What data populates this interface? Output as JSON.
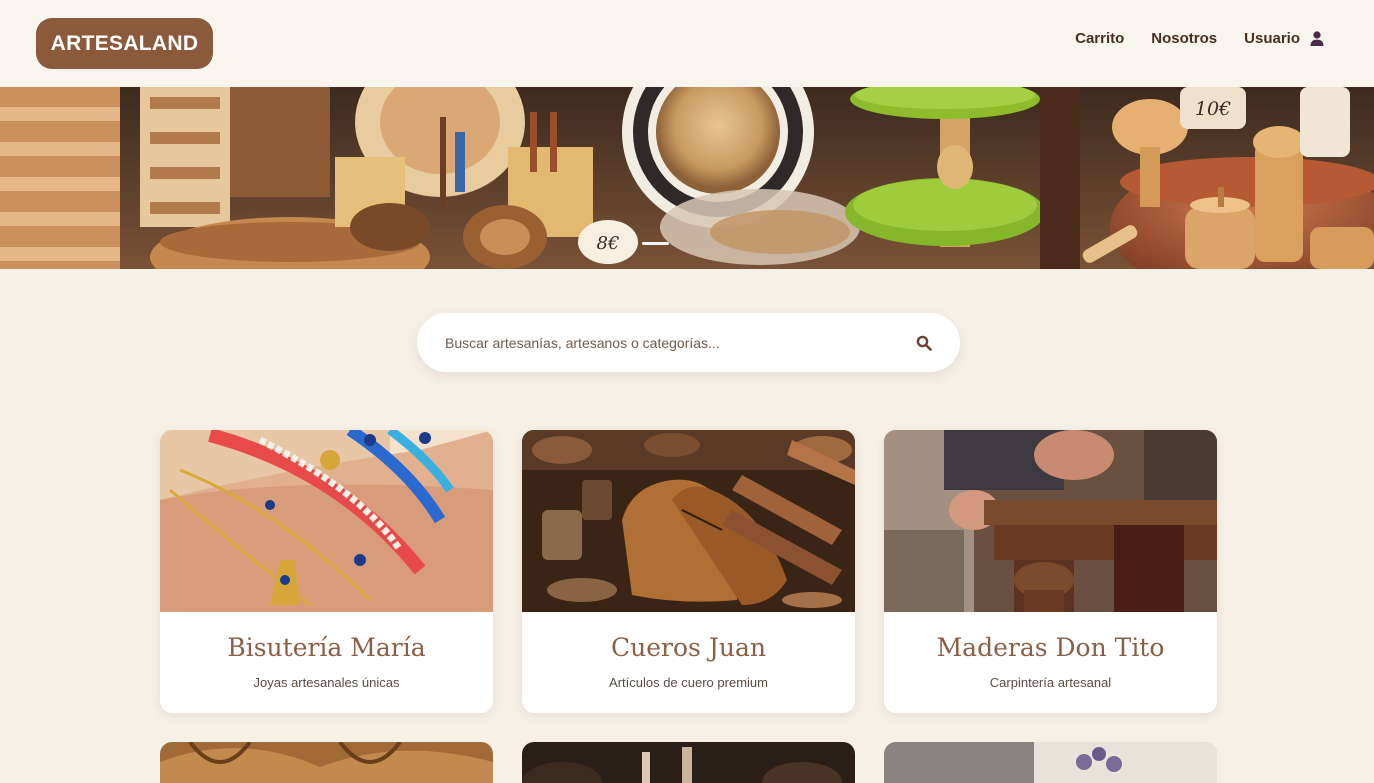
{
  "header": {
    "logo": "ARTESALAND",
    "nav": [
      {
        "label": "Carrito"
      },
      {
        "label": "Nosotros"
      },
      {
        "label": "Usuario"
      }
    ]
  },
  "hero": {
    "price_tags": [
      "8€",
      "10€"
    ]
  },
  "search": {
    "placeholder": "Buscar artesanías, artesanos o categorías..."
  },
  "cards": [
    {
      "title": "Bisutería María",
      "subtitle": "Joyas artesanales únicas"
    },
    {
      "title": "Cueros Juan",
      "subtitle": "Artículos de cuero premium"
    },
    {
      "title": "Maderas Don Tito",
      "subtitle": "Carpintería artesanal"
    }
  ],
  "colors": {
    "background": "#f6f0e7",
    "brand": "#8a5a3b",
    "nav_text": "#4a2f1f",
    "card_title": "#8a5f45",
    "user_icon": "#4a2a4a"
  },
  "icons": {
    "user": "user-icon",
    "search": "search-icon"
  }
}
